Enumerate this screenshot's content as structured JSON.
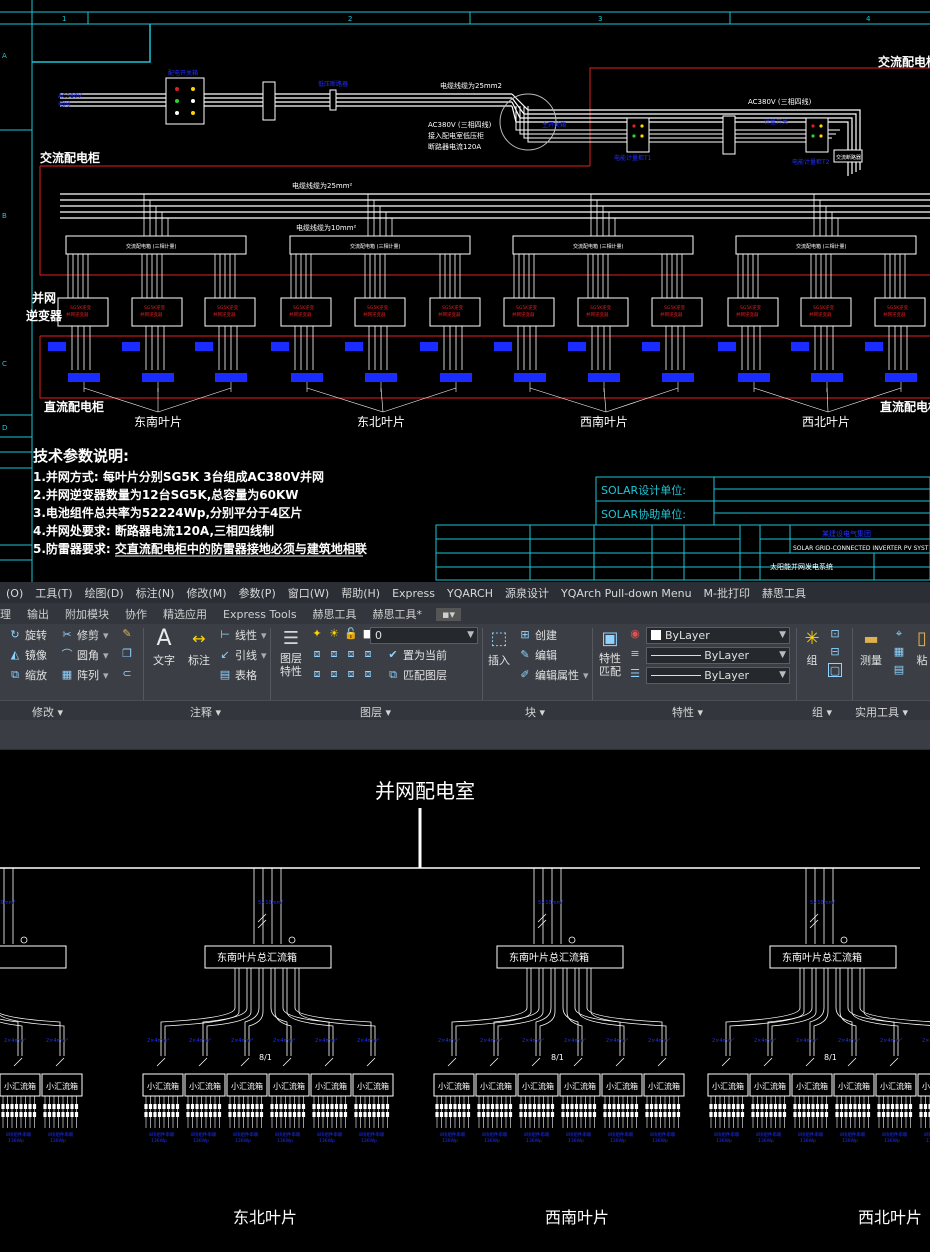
{
  "top_drawing": {
    "grid_numbers": [
      "1",
      "2",
      "3",
      "4"
    ],
    "grid_letters": [
      "A",
      "B",
      "C",
      "D"
    ],
    "labels": {
      "ac_cabinet_right": "交流配电柜",
      "ac_cabinet_left": "交流配电柜",
      "cable_top": "电缆线缆为25mm2",
      "ac380_right": "AC380V (三相四线)",
      "ac380_note_1": "AC380V (三相四线)",
      "ac380_note_2": "接入配电室低压柜",
      "ac380_note_3": "断路器电流120A",
      "cable_bus": "电缆线缆为25mm²",
      "cable_sub": "电缆线缆为10mm²",
      "grid_inverter_1": "并网",
      "grid_inverter_2": "逆变器",
      "dc_cabinet_left": "直流配电柜",
      "dc_cabinet_right": "直流配电柜"
    },
    "zones": [
      "东南叶片",
      "东北叶片",
      "西南叶片",
      "西北叶片"
    ],
    "tech_title": "技术参数说明:",
    "tech_items": [
      "1.并网方式: 每叶片分别SG5K 3台组成AC380V并网",
      "2.并网逆变器数量为12台SG5K,总容量为60KW",
      "3.电池组件总共率为52224Wp,分别平分于4区片",
      "4.并网处要求: 断路器电流120A,三相四线制",
      "5.防雷器要求: 交直流配电柜中的防雷器接地必须与建筑地相联"
    ],
    "title_block": {
      "design_unit": "SOLAR设计单位:",
      "assist_unit": "SOLAR协助单位:",
      "drawing_name_en": "SOLAR GRID-CONNECTED INVERTER PV SYST",
      "drawing_name_cn": "太阳能并网发电系统"
    }
  },
  "ribbon": {
    "menu": [
      "(O)",
      "工具(T)",
      "绘图(D)",
      "标注(N)",
      "修改(M)",
      "参数(P)",
      "窗口(W)",
      "帮助(H)",
      "Express",
      "YQARCH",
      "源泉设计",
      "YQArch Pull-down Menu",
      "M-批打印",
      "赫思工具"
    ],
    "tabs": [
      "理",
      "输出",
      "附加模块",
      "协作",
      "精选应用",
      "Express Tools",
      "赫思工具",
      "赫思工具*"
    ],
    "modify_tools": [
      "旋转",
      "修剪",
      "镜像",
      "圆角",
      "缩放",
      "阵列"
    ],
    "text_label": "文字",
    "dim_label": "标注",
    "annot_tools": [
      "线性",
      "引线",
      "表格"
    ],
    "layer_props": "图层特性",
    "layer_value": "0",
    "layer_tools": [
      "置为当前",
      "匹配图层"
    ],
    "insert_label": "插入",
    "block_tools": [
      "创建",
      "编辑",
      "编辑属性"
    ],
    "match_label": "特性匹配",
    "bylayer_1": "ByLayer",
    "bylayer_2": "ByLayer",
    "bylayer_3": "ByLayer",
    "group_label": "组",
    "measure_label": "测量",
    "paste_label": "粘",
    "panels": [
      "修改 ▾",
      "注释 ▾",
      "图层 ▾",
      "块 ▾",
      "特性 ▾",
      "组 ▾",
      "实用工具 ▾"
    ]
  },
  "bottom_drawing": {
    "room_title": "并网配电室",
    "combiner_main": "东南叶片总汇流箱",
    "combiner_left_partial": "流箱",
    "small_combiner": "小汇流箱",
    "ratio_label": "8/1",
    "zones": [
      "东北叶片",
      "西南叶片",
      "西北叶片"
    ]
  }
}
